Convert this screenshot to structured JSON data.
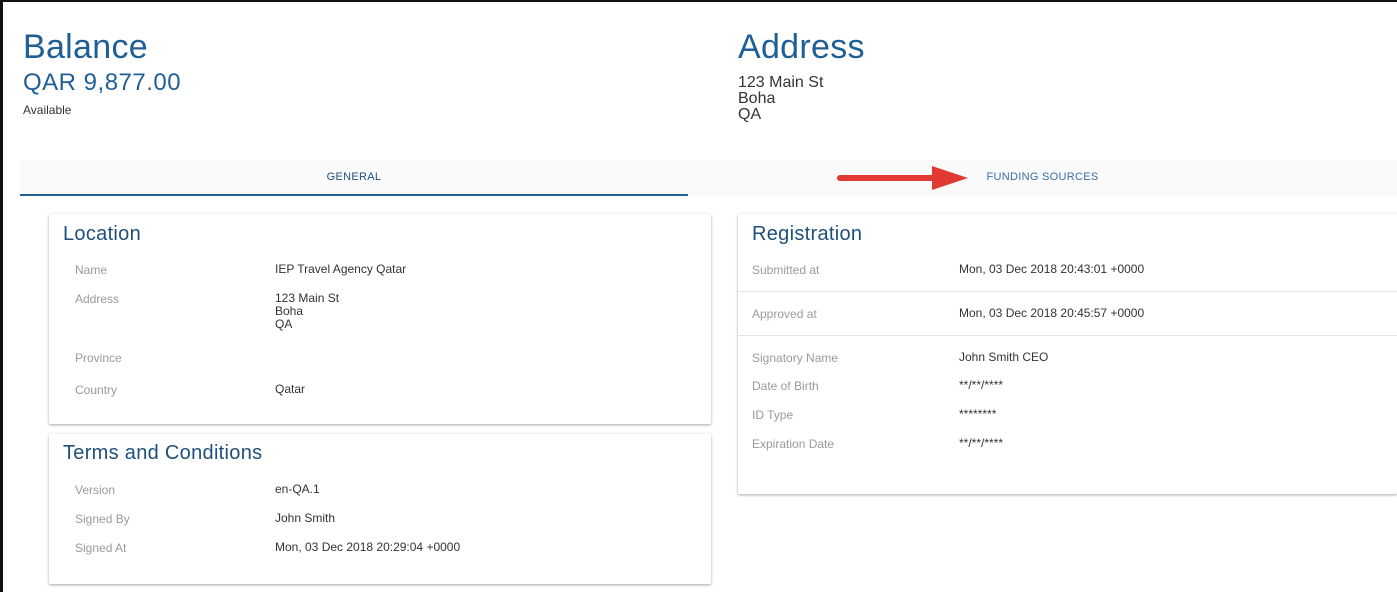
{
  "balance": {
    "title": "Balance",
    "amount": "QAR 9,877.00",
    "status": "Available"
  },
  "address": {
    "title": "Address",
    "line1": "123 Main St",
    "line2": "Boha",
    "line3": "QA"
  },
  "tabs": [
    {
      "label": "GENERAL",
      "active": true
    },
    {
      "label": "FUNDING SOURCES",
      "active": false
    }
  ],
  "location": {
    "title": "Location",
    "name_label": "Name",
    "name_value": "IEP Travel Agency Qatar",
    "address_label": "Address",
    "address_line1": "123 Main St",
    "address_line2": "Boha",
    "address_line3": "QA",
    "province_label": "Province",
    "province_value": "",
    "country_label": "Country",
    "country_value": "Qatar"
  },
  "terms": {
    "title": "Terms and Conditions",
    "version_label": "Version",
    "version_value": "en-QA.1",
    "signed_by_label": "Signed By",
    "signed_by_value": "John Smith",
    "signed_at_label": "Signed At",
    "signed_at_value": "Mon, 03 Dec 2018 20:29:04 +0000"
  },
  "registration": {
    "title": "Registration",
    "submitted_label": "Submitted at",
    "submitted_value": "Mon, 03 Dec 2018 20:43:01 +0000",
    "approved_label": "Approved at",
    "approved_value": "Mon, 03 Dec 2018 20:45:57 +0000",
    "signatory_label": "Signatory Name",
    "signatory_value": "John Smith CEO",
    "dob_label": "Date of Birth",
    "dob_value": "**/**/****",
    "id_type_label": "ID Type",
    "id_type_value": "********",
    "expiration_label": "Expiration Date",
    "expiration_value": "**/**/****"
  },
  "colors": {
    "accent": "#1f5f96",
    "annotation_arrow": "#e03a32"
  }
}
